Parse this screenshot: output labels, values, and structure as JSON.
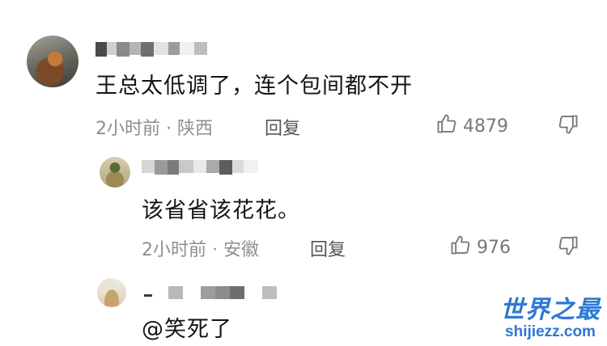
{
  "comments": [
    {
      "text": "王总太低调了，连个包间都不开",
      "time_location": "2小时前 · 陕西",
      "reply_label": "回复",
      "likes": "4879"
    },
    {
      "text": "该省省该花花。",
      "time_location": "2小时前 · 安徽",
      "reply_label": "回复",
      "likes": "976"
    },
    {
      "text": "@笑死了"
    }
  ],
  "icons": {
    "like": "thumbs-up-icon",
    "dislike": "thumbs-down-icon"
  },
  "watermark": {
    "cn": "世界之最",
    "en": "shijiezz.com"
  },
  "colors": {
    "meta_text": "#8e8e8e",
    "watermark": "#2c78d4"
  }
}
